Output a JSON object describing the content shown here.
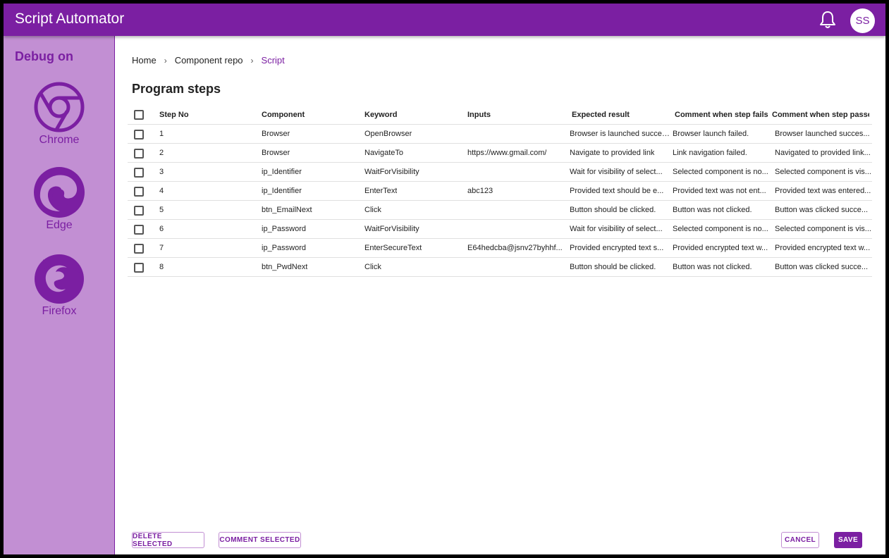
{
  "app": {
    "title": "Script Automator",
    "avatar_initials": "SS",
    "accent": "#7b1fa2",
    "sidebar_bg": "#c28fd3"
  },
  "header_icons": {
    "notifications": "bell-icon"
  },
  "sidebar": {
    "title": "Debug on",
    "browsers": [
      {
        "label": "Chrome",
        "icon": "chrome-icon"
      },
      {
        "label": "Edge",
        "icon": "edge-icon"
      },
      {
        "label": "Firefox",
        "icon": "firefox-icon"
      }
    ]
  },
  "breadcrumb": {
    "items": [
      "Home",
      "Component repo",
      "Script"
    ],
    "separator": "›"
  },
  "page": {
    "title": "Program steps"
  },
  "table": {
    "headers": {
      "step": "Step No",
      "component": "Component",
      "keyword": "Keyword",
      "inputs": "Inputs",
      "expected": "Expected result",
      "fail": "Comment when step fails",
      "pass": "Comment when step passes"
    },
    "rows": [
      {
        "step": "1",
        "component": "Browser",
        "keyword": "OpenBrowser",
        "inputs": "",
        "expected": "Browser is launched succes...",
        "fail": "Browser launch failed.",
        "pass": "Browser launched succes..."
      },
      {
        "step": "2",
        "component": "Browser",
        "keyword": "NavigateTo",
        "inputs": "https://www.gmail.com/",
        "expected": "Navigate to provided link",
        "fail": "Link navigation failed.",
        "pass": "Navigated to provided link..."
      },
      {
        "step": "3",
        "component": "ip_Identifier",
        "keyword": "WaitForVisibility",
        "inputs": "",
        "expected": "Wait for visibility of select...",
        "fail": "Selected component is no...",
        "pass": "Selected component is vis..."
      },
      {
        "step": "4",
        "component": "ip_Identifier",
        "keyword": "EnterText",
        "inputs": "abc123",
        "expected": "Provided text should be e...",
        "fail": "Provided text was not ent...",
        "pass": "Provided text was entered..."
      },
      {
        "step": "5",
        "component": "btn_EmailNext",
        "keyword": "Click",
        "inputs": "",
        "expected": "Button should be clicked.",
        "fail": "Button was not clicked.",
        "pass": "Button was clicked succe..."
      },
      {
        "step": "6",
        "component": "ip_Password",
        "keyword": "WaitForVisibility",
        "inputs": "",
        "expected": "Wait for visibility of select...",
        "fail": "Selected component is no...",
        "pass": "Selected component is vis..."
      },
      {
        "step": "7",
        "component": "ip_Password",
        "keyword": "EnterSecureText",
        "inputs": "E64hedcba@jsnv27byhhf...",
        "expected": "Provided encrypted text s...",
        "fail": "Provided encrypted text w...",
        "pass": "Provided encrypted text w..."
      },
      {
        "step": "8",
        "component": "btn_PwdNext",
        "keyword": "Click",
        "inputs": "",
        "expected": "Button should be clicked.",
        "fail": "Button was not clicked.",
        "pass": "Button was clicked succe..."
      }
    ]
  },
  "actions": {
    "delete_selected": "DELETE SELECTED",
    "comment_selected": "COMMENT SELECTED",
    "cancel": "CANCEL",
    "save": "SAVE"
  }
}
